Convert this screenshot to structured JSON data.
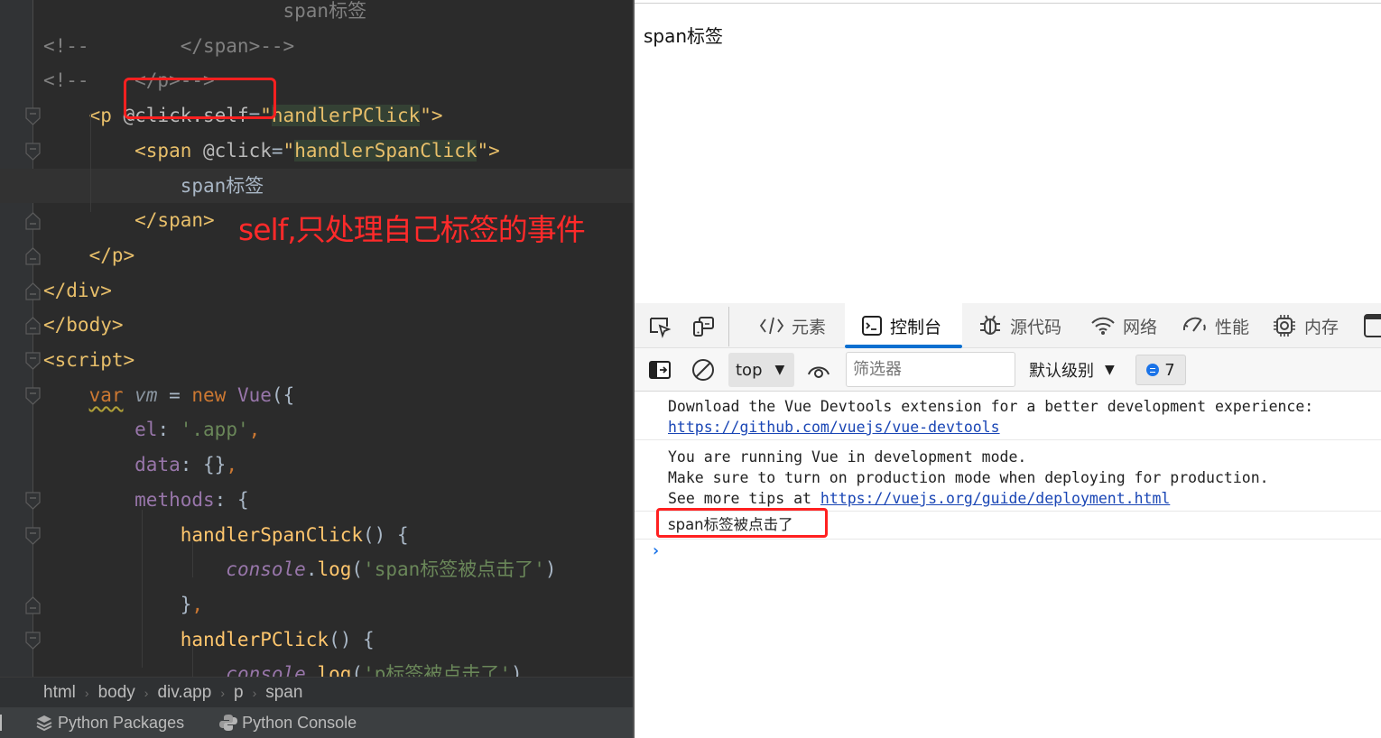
{
  "editor": {
    "lines": [
      {
        "indent": "            ",
        "parts": [
          {
            "c": "cmt",
            "t": "                     span标签"
          }
        ]
      },
      {
        "parts": [
          {
            "c": "cmt",
            "t": "<!--        </span>-->"
          }
        ]
      },
      {
        "parts": [
          {
            "c": "cmt",
            "t": "<!--    </p>-->"
          }
        ]
      },
      {
        "parts": [
          {
            "c": "tag",
            "t": "    <p "
          },
          {
            "c": "attr",
            "t": "@click.self"
          },
          {
            "c": "plain",
            "t": "="
          },
          {
            "c": "tag",
            "t": "\""
          },
          {
            "c": "attrval",
            "t": "handlerPClick"
          },
          {
            "c": "tag",
            "t": "\">"
          }
        ]
      },
      {
        "parts": [
          {
            "c": "tag",
            "t": "        <span "
          },
          {
            "c": "attr",
            "t": "@click"
          },
          {
            "c": "plain",
            "t": "="
          },
          {
            "c": "tag",
            "t": "\""
          },
          {
            "c": "attrval",
            "t": "handlerSpanClick"
          },
          {
            "c": "tag",
            "t": "\">"
          }
        ]
      },
      {
        "parts": [
          {
            "c": "plain",
            "t": "            span标签"
          }
        ],
        "current": true
      },
      {
        "parts": [
          {
            "c": "tag",
            "t": "        </span>"
          }
        ]
      },
      {
        "parts": [
          {
            "c": "tag",
            "t": "    </p>"
          }
        ]
      },
      {
        "parts": [
          {
            "c": "tag",
            "t": "</div>"
          }
        ]
      },
      {
        "parts": [
          {
            "c": "tag",
            "t": "</body>"
          }
        ]
      },
      {
        "parts": [
          {
            "c": "tag",
            "t": "<script>"
          }
        ]
      },
      {
        "parts": [
          {
            "c": "plain",
            "t": "    "
          },
          {
            "c": "kw squig",
            "t": "var"
          },
          {
            "c": "plain",
            "t": " "
          },
          {
            "c": "vmvar",
            "t": "vm"
          },
          {
            "c": "plain",
            "t": " = "
          },
          {
            "c": "kw",
            "t": "new "
          },
          {
            "c": "cls",
            "t": "Vue"
          },
          {
            "c": "plain",
            "t": "({"
          }
        ]
      },
      {
        "parts": [
          {
            "c": "plain",
            "t": "        "
          },
          {
            "c": "prop",
            "t": "el"
          },
          {
            "c": "plain",
            "t": ": "
          },
          {
            "c": "str",
            "t": "'.app'"
          },
          {
            "c": "kw",
            "t": ","
          }
        ]
      },
      {
        "parts": [
          {
            "c": "plain",
            "t": "        "
          },
          {
            "c": "prop",
            "t": "data"
          },
          {
            "c": "plain",
            "t": ": {}"
          },
          {
            "c": "kw",
            "t": ","
          }
        ]
      },
      {
        "parts": [
          {
            "c": "plain",
            "t": "        "
          },
          {
            "c": "prop",
            "t": "methods"
          },
          {
            "c": "plain",
            "t": ": {"
          }
        ]
      },
      {
        "parts": [
          {
            "c": "plain",
            "t": "            "
          },
          {
            "c": "fn",
            "t": "handlerSpanClick"
          },
          {
            "c": "plain",
            "t": "() {"
          }
        ]
      },
      {
        "parts": [
          {
            "c": "plain",
            "t": "                "
          },
          {
            "c": "ital",
            "t": "console"
          },
          {
            "c": "plain",
            "t": "."
          },
          {
            "c": "fn",
            "t": "log"
          },
          {
            "c": "plain",
            "t": "("
          },
          {
            "c": "str",
            "t": "'span标签被点击了'"
          },
          {
            "c": "plain",
            "t": ")"
          }
        ]
      },
      {
        "parts": [
          {
            "c": "plain",
            "t": "            }"
          },
          {
            "c": "kw",
            "t": ","
          }
        ]
      },
      {
        "parts": [
          {
            "c": "plain",
            "t": "            "
          },
          {
            "c": "fn",
            "t": "handlerPClick"
          },
          {
            "c": "plain",
            "t": "() {"
          }
        ]
      },
      {
        "parts": [
          {
            "c": "plain",
            "t": "                "
          },
          {
            "c": "ital",
            "t": "console"
          },
          {
            "c": "plain",
            "t": "."
          },
          {
            "c": "fn",
            "t": "log"
          },
          {
            "c": "plain",
            "t": "("
          },
          {
            "c": "str",
            "t": "'p标签被点击了'"
          },
          {
            "c": "plain",
            "t": ")"
          }
        ]
      }
    ],
    "fold_markers": [
      {
        "line": 3,
        "dir": "open"
      },
      {
        "line": 4,
        "dir": "open"
      },
      {
        "line": 6,
        "dir": "close"
      },
      {
        "line": 7,
        "dir": "close"
      },
      {
        "line": 8,
        "dir": "close"
      },
      {
        "line": 9,
        "dir": "close"
      },
      {
        "line": 10,
        "dir": "open"
      },
      {
        "line": 11,
        "dir": "open"
      },
      {
        "line": 14,
        "dir": "open"
      },
      {
        "line": 15,
        "dir": "open"
      },
      {
        "line": 17,
        "dir": "close"
      },
      {
        "line": 18,
        "dir": "open"
      }
    ],
    "annotation": "self,只处理自己标签的事件",
    "breadcrumb": [
      "html",
      "body",
      "div.app",
      "p",
      "span"
    ],
    "tool_windows": [
      {
        "label": "Python Packages",
        "icon": "layers-icon"
      },
      {
        "label": "Python Console",
        "icon": "python-icon"
      }
    ]
  },
  "browser": {
    "page_text": "span标签",
    "devtools": {
      "tabs": [
        {
          "label": "元素",
          "icon": "code-brackets-icon"
        },
        {
          "label": "控制台",
          "icon": "console-icon",
          "active": true
        },
        {
          "label": "源代码",
          "icon": "bug-icon"
        },
        {
          "label": "网络",
          "icon": "wifi-icon"
        },
        {
          "label": "性能",
          "icon": "gauge-icon"
        },
        {
          "label": "内存",
          "icon": "chip-icon"
        }
      ],
      "toolbar": {
        "context": "top",
        "filter_placeholder": "筛选器",
        "level": "默认级别",
        "message_count": "7"
      },
      "console": {
        "msg1_line1": "Download the Vue Devtools extension for a better development experience:",
        "msg1_link": "https://github.com/vuejs/vue-devtools",
        "msg2_line1": "You are running Vue in development mode.",
        "msg2_line2": "Make sure to turn on production mode when deploying for production.",
        "msg2_line3_prefix": "See more tips at ",
        "msg2_link": "https://vuejs.org/guide/deployment.html",
        "msg3": "span标签被点击了",
        "prompt": "›"
      }
    }
  },
  "colors": {
    "annotation_red": "#ff2020",
    "devtools_accent": "#0a6fd0",
    "link": "#1a46b5"
  }
}
